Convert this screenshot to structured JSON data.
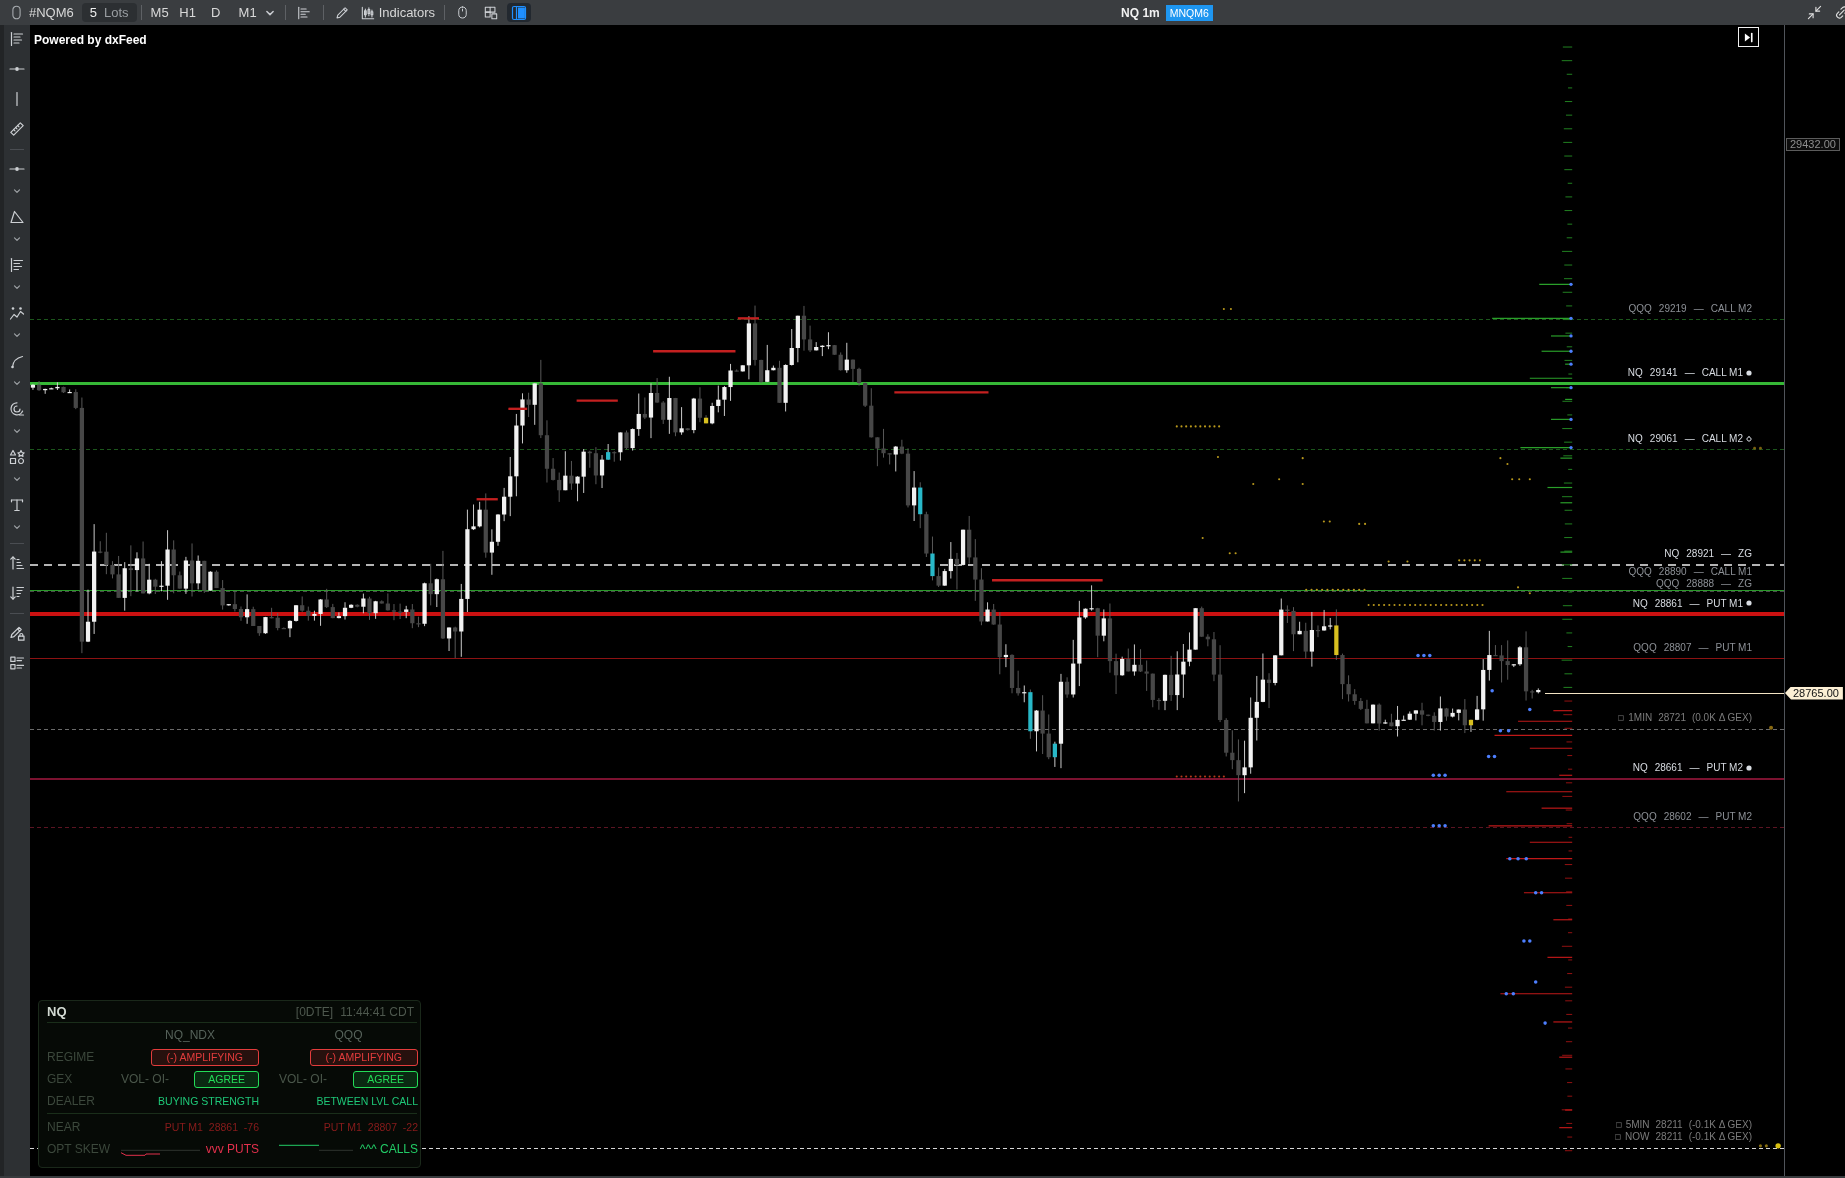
{
  "toolbar": {
    "symbol": "#NQM6",
    "lots": {
      "value": "5",
      "unit": "Lots"
    },
    "timeframes": [
      "M5",
      "H1",
      "D"
    ],
    "timeframe_dropdown": "M1",
    "indicators_label": "Indicators",
    "panel_toggle": {
      "on": true
    }
  },
  "chart_header": {
    "title": "NQ 1m",
    "contract": "MNQM6"
  },
  "chart": {
    "attribution": "Powered by dxFeed",
    "levels": [
      {
        "symbol": "QQQ",
        "price": "29219",
        "separator": "—",
        "tag": "CALL M2",
        "bright": false,
        "marked": false,
        "kind": "dashed",
        "color": "#1c561c"
      },
      {
        "symbol": "NQ",
        "price": "29141",
        "separator": "—",
        "tag": "CALL M1",
        "bright": true,
        "marked": true,
        "filled": true,
        "kind": "bold",
        "color": "#36b836"
      },
      {
        "symbol": "NQ",
        "price": "29061",
        "separator": "—",
        "tag": "CALL M2",
        "bright": true,
        "marked": true,
        "filled": false,
        "kind": "dashed",
        "color": "#1c561c"
      },
      {
        "symbol": "NQ",
        "price": "28921",
        "separator": "—",
        "tag": "ZG",
        "bright": true,
        "marked": false,
        "kind": "dashedbold",
        "color": "#b4b4b4"
      },
      {
        "symbol": "QQQ",
        "price": "28890",
        "separator": "—",
        "tag": "CALL M1",
        "bright": false,
        "marked": false,
        "kind": "thin",
        "color": "#2a9a2a"
      },
      {
        "symbol": "QQQ",
        "price": "28888",
        "separator": "—",
        "tag": "ZG",
        "bright": false,
        "marked": false,
        "kind": "dashed",
        "color": "#4a4a4a"
      },
      {
        "symbol": "NQ",
        "price": "28861",
        "separator": "—",
        "tag": "PUT M1",
        "bright": true,
        "marked": true,
        "filled": true,
        "kind": "thick",
        "color": "#cc1111"
      },
      {
        "symbol": "QQQ",
        "price": "28807",
        "separator": "—",
        "tag": "PUT M1",
        "bright": false,
        "marked": false,
        "kind": "thin",
        "color": "#8c1212"
      },
      {
        "symbol": "NQ",
        "price": "28661",
        "separator": "—",
        "tag": "PUT M2",
        "bright": true,
        "marked": true,
        "filled": true,
        "kind": "medium",
        "color": "#7c1230"
      },
      {
        "symbol": "QQQ",
        "price": "28602",
        "separator": "—",
        "tag": "PUT M2",
        "bright": false,
        "marked": false,
        "kind": "dashed",
        "color": "#5c1422"
      }
    ],
    "delta_groups": [
      {
        "color": "#6a6a6a",
        "labels": [
          {
            "window": "1MIN",
            "price": "28721",
            "delta": "(0.0K Δ GEX)"
          }
        ]
      },
      {
        "color": "#d6d6d6",
        "labels": [
          {
            "window": "5MIN",
            "price": "28211",
            "delta": "(-0.1K Δ GEX)"
          },
          {
            "window": "NOW",
            "price": "28211",
            "delta": "(-0.1K Δ GEX)"
          }
        ]
      }
    ]
  },
  "price_axis": [
    {
      "text": "29432.00",
      "kind": "marker"
    },
    {
      "text": "28765.00",
      "kind": "last"
    }
  ],
  "gex_panel": {
    "title": "NQ",
    "session": "[0DTE]",
    "time": "11:44:41 CDT",
    "columns": [
      "NQ_NDX",
      "QQQ"
    ],
    "sections": [
      {
        "rows": [
          {
            "kind": "badge",
            "label": "REGIME",
            "cells": [
              {
                "badge": "(-) AMPLIFYING",
                "color": "#e23c3c"
              },
              {
                "badge": "(-) AMPLIFYING",
                "color": "#e23c3c"
              }
            ]
          },
          {
            "kind": "pair",
            "label": "GEX",
            "cells": [
              {
                "text": "VOL- OI-",
                "badge": "AGREE",
                "color": "#24dc58"
              },
              {
                "text": "VOL- OI-",
                "badge": "AGREE",
                "color": "#24dc58"
              }
            ]
          },
          {
            "kind": "text",
            "label": "DEALER",
            "cells": [
              {
                "text": "BUYING STRENGTH",
                "color": "#1ec878"
              },
              {
                "text": "BETWEEN LVL CALL",
                "color": "#1ec878"
              }
            ]
          }
        ]
      },
      {
        "rows": [
          {
            "kind": "text",
            "label": "NEAR",
            "cells": [
              {
                "text": "PUT M1  28861  -76",
                "color": "#8a1c1c"
              },
              {
                "text": "PUT M1  28807  -22",
                "color": "#8a1c1c"
              }
            ]
          },
          {
            "kind": "skew",
            "label": "OPT SKEW",
            "cells": [
              {
                "text": "vvv PUTS",
                "color": "#e2304c"
              },
              {
                "text": "^^^ CALLS",
                "color": "#22cc66"
              }
            ]
          }
        ]
      }
    ]
  }
}
